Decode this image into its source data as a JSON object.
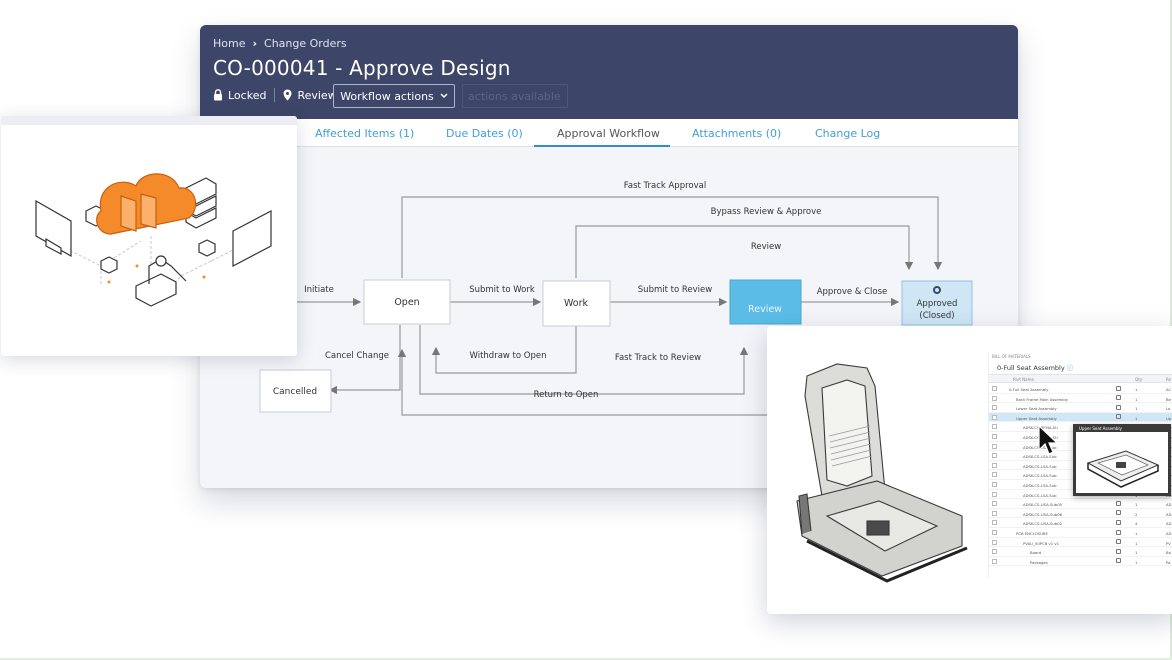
{
  "breadcrumb": {
    "home": "Home",
    "current": "Change Orders"
  },
  "title": "CO-000041 - Approve Design",
  "status": {
    "locked": "Locked",
    "state": "Review",
    "workflow_actions": "Workflow actions",
    "ghost": "actions available"
  },
  "tabs": [
    {
      "label": "Affected Items (1)"
    },
    {
      "label": "Due Dates (0)"
    },
    {
      "label": "Approval Workflow",
      "active": true
    },
    {
      "label": "Attachments (0)"
    },
    {
      "label": "Change Log"
    }
  ],
  "workflow": {
    "states": {
      "open": "Open",
      "work": "Work",
      "review": "Review",
      "approved_line1": "Approved",
      "approved_line2": "(Closed)",
      "cancelled": "Cancelled"
    },
    "transitions": {
      "fast_track_approval": "Fast Track Approval",
      "bypass": "Bypass Review & Approve",
      "review": "Review",
      "initiate": "Initiate",
      "submit_work": "Submit to Work",
      "submit_review": "Submit to Review",
      "approve_close": "Approve & Close",
      "cancel_change": "Cancel Change",
      "withdraw": "Withdraw to Open",
      "fast_track_review": "Fast Track to Review",
      "return_open": "Return to Open"
    }
  },
  "bom": {
    "breadcrumb": "BILL OF MATERIALS",
    "title": "0-Full Seat Assembly",
    "columns": {
      "part": "Part Name",
      "qty": "Qty",
      "rev": "Re"
    },
    "tooltip": "Upper Seat Assembly",
    "rows": [
      {
        "indent": 0,
        "name": "0-Full Seat Assembly",
        "qty": "1",
        "rev": "AC"
      },
      {
        "indent": 1,
        "name": "Back Frame Main Assembly",
        "qty": "1",
        "rev": "Be"
      },
      {
        "indent": 1,
        "name": "Lower Seat Assembly",
        "qty": "1",
        "rev": "Lo"
      },
      {
        "indent": 1,
        "name": "Upper Seat Assembly",
        "qty": "1",
        "rev": "Up",
        "selected": true
      },
      {
        "indent": 2,
        "name": "ADSK-CS-BFMA-SU",
        "qty": "1",
        "rev": "AD"
      },
      {
        "indent": 2,
        "name": "ADSK-CS-BFMA-SU",
        "qty": "1",
        "rev": "AD"
      },
      {
        "indent": 2,
        "name": "ADSK-CS-LSA-Sub",
        "qty": "1",
        "rev": "AD"
      },
      {
        "indent": 2,
        "name": "ADSK-CS-LSA-Sub",
        "qty": "1",
        "rev": "AD"
      },
      {
        "indent": 2,
        "name": "ADSK-CS-LSA-Sub",
        "qty": "1",
        "rev": "AD"
      },
      {
        "indent": 2,
        "name": "ADSK-CS-LSA-Sub",
        "qty": "1",
        "rev": "AD"
      },
      {
        "indent": 2,
        "name": "ADSK-CS-LSA-Sub",
        "qty": "1",
        "rev": "AD"
      },
      {
        "indent": 2,
        "name": "ADSK-CS-LSA-Sub",
        "qty": "1",
        "rev": "AD"
      },
      {
        "indent": 2,
        "name": "ADSK-CS-USA-Sub05",
        "qty": "1",
        "rev": "AD"
      },
      {
        "indent": 2,
        "name": "ADSK-CS-USA-Sub06",
        "qty": "2",
        "rev": "AD"
      },
      {
        "indent": 2,
        "name": "ADSK-CS-USA-Sub02",
        "qty": "4",
        "rev": "AD"
      },
      {
        "indent": 1,
        "name": "PCB ENCLOSURE",
        "qty": "1",
        "rev": "AD"
      },
      {
        "indent": 2,
        "name": "PVAU_50PCB v1 v1",
        "qty": "1",
        "rev": "PV"
      },
      {
        "indent": 3,
        "name": "Board",
        "qty": "1",
        "rev": "Bo"
      },
      {
        "indent": 3,
        "name": "Packages",
        "qty": "1",
        "rev": "Pa"
      }
    ]
  },
  "colors": {
    "header": "#3d4568",
    "accent": "#3f9fd6",
    "review": "#5bbde6",
    "approved": "#cfe6f5",
    "orange": "#f58a2a"
  }
}
